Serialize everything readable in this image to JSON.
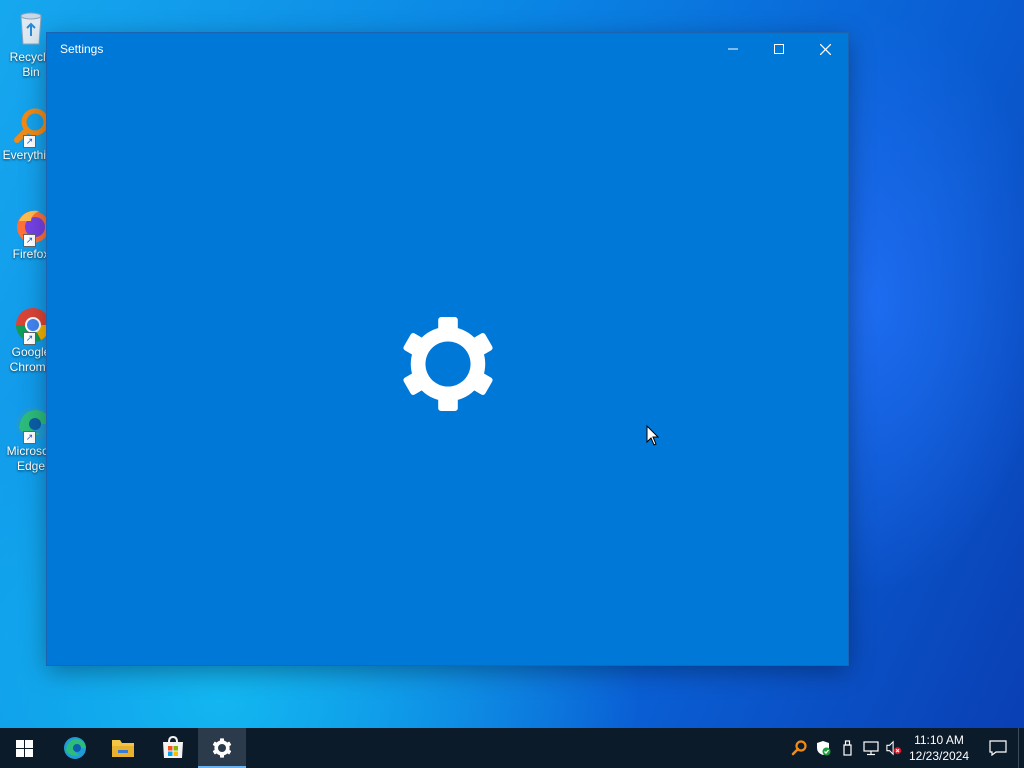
{
  "desktop": {
    "icons": [
      {
        "label": "Recycle Bin",
        "icon": "recycle-bin-icon"
      },
      {
        "label": "Everything",
        "icon": "everything-search-icon"
      },
      {
        "label": "Firefox",
        "icon": "firefox-icon"
      },
      {
        "label": "Google Chrome",
        "icon": "chrome-icon"
      },
      {
        "label": "Microsoft Edge",
        "icon": "edge-icon"
      }
    ]
  },
  "window": {
    "title": "Settings",
    "controls": {
      "minimize": "minimize-icon",
      "maximize": "maximize-icon",
      "close": "close-icon"
    },
    "splash_icon": "gear-icon",
    "background_color": "#0078d7"
  },
  "taskbar": {
    "apps": [
      {
        "name": "Start",
        "icon": "windows-logo-icon"
      },
      {
        "name": "Microsoft Edge",
        "icon": "edge-icon"
      },
      {
        "name": "File Explorer",
        "icon": "folder-icon"
      },
      {
        "name": "Microsoft Store",
        "icon": "store-icon"
      },
      {
        "name": "Settings",
        "icon": "gear-icon",
        "active": true
      }
    ],
    "tray": [
      "everything-search-icon",
      "security-shield-icon",
      "usb-drive-icon",
      "network-icon",
      "volume-muted-icon"
    ],
    "clock": {
      "time": "11:10 AM",
      "date": "12/23/2024"
    },
    "notification_icon": "notification-icon"
  }
}
